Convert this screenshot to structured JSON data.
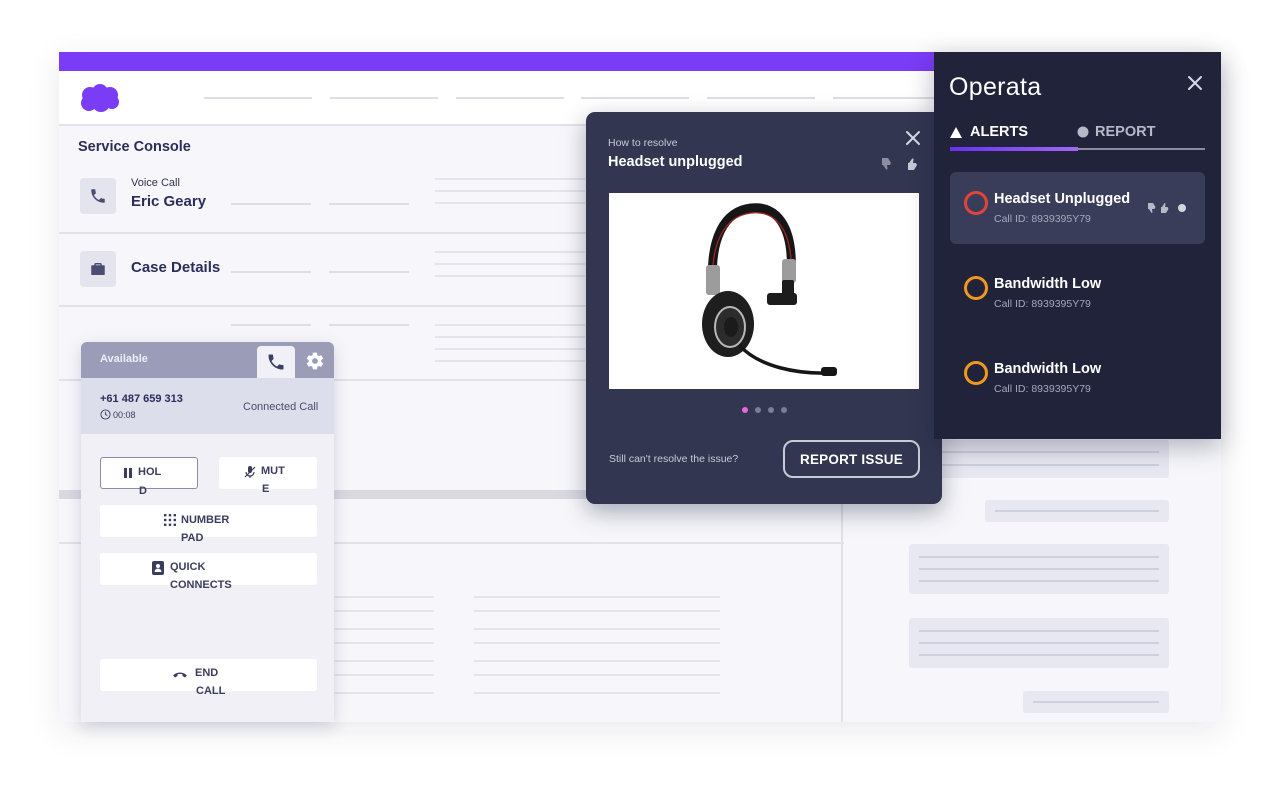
{
  "console": {
    "title": "Service Console",
    "voice_call_label": "Voice Call",
    "caller_name": "Eric Geary",
    "case_details": "Case Details",
    "brand_color": "#7b3cf5"
  },
  "softphone": {
    "status": "Available",
    "phone_number": "+61 487 659 313",
    "timer": "00:08",
    "call_state": "Connected Call",
    "hold_label_1": "HOL",
    "hold_label_2": "D",
    "mute_label_1": "MUT",
    "mute_label_2": "E",
    "numpad_label_1": "NUMBER",
    "numpad_label_2": "PAD",
    "quick_label_1": "QUICK",
    "quick_label_2": "CONNECTS",
    "end_label_1": "END",
    "end_label_2": "CALL"
  },
  "modal": {
    "kicker": "How to resolve",
    "title": "Headset unplugged",
    "footer_text": "Still can't  resolve the issue?",
    "report_button": "REPORT ISSUE",
    "slide_count": 4,
    "active_slide": 1,
    "active_dot_color": "#e36ad8"
  },
  "operata": {
    "logo": "Operata",
    "tab_alerts": "ALERTS",
    "tab_report": "REPORT",
    "alerts": [
      {
        "title": "Headset Unplugged",
        "call_id": "Call ID: 8939395Y79",
        "severity": "red"
      },
      {
        "title": "Bandwidth Low",
        "call_id": "Call ID: 8939395Y79",
        "severity": "orange"
      },
      {
        "title": "Bandwidth Low",
        "call_id": "Call ID: 8939395Y79",
        "severity": "orange"
      }
    ],
    "colors": {
      "red": "#e2443b",
      "orange": "#ef9a1c",
      "panel": "#21233a"
    }
  }
}
